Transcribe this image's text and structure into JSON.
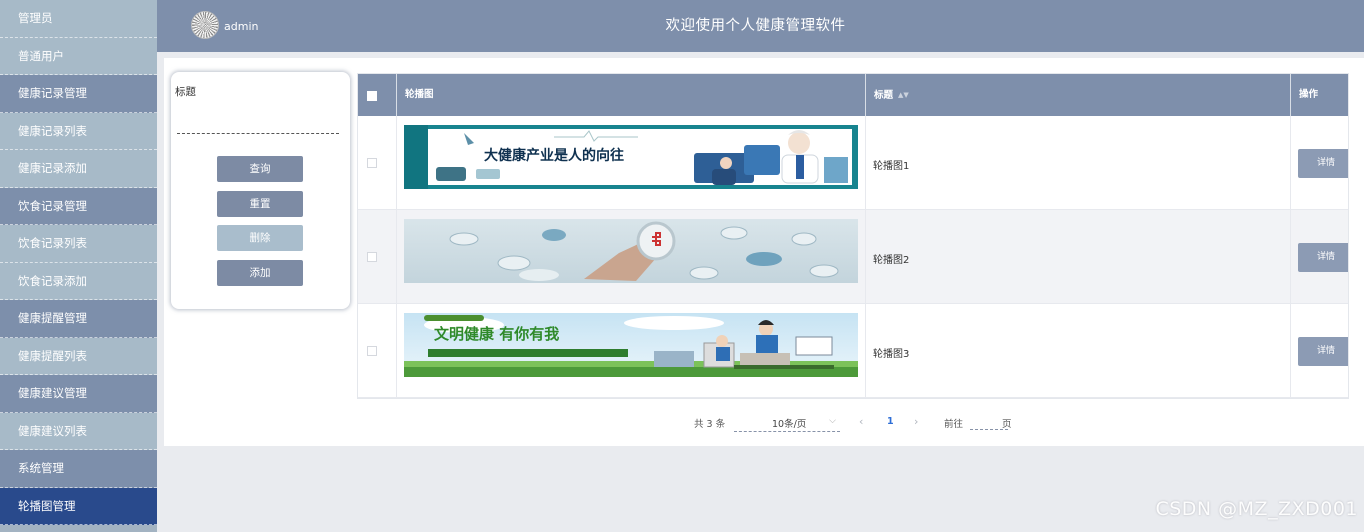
{
  "sidebar": {
    "items": [
      {
        "label": "管理员",
        "kind": "sub"
      },
      {
        "label": "普通用户",
        "kind": "sub"
      },
      {
        "label": "健康记录管理",
        "kind": "group"
      },
      {
        "label": "健康记录列表",
        "kind": "sub"
      },
      {
        "label": "健康记录添加",
        "kind": "sub"
      },
      {
        "label": "饮食记录管理",
        "kind": "group"
      },
      {
        "label": "饮食记录列表",
        "kind": "sub"
      },
      {
        "label": "饮食记录添加",
        "kind": "sub"
      },
      {
        "label": "健康提醒管理",
        "kind": "group"
      },
      {
        "label": "健康提醒列表",
        "kind": "sub"
      },
      {
        "label": "健康建议管理",
        "kind": "group"
      },
      {
        "label": "健康建议列表",
        "kind": "sub"
      },
      {
        "label": "系统管理",
        "kind": "group"
      },
      {
        "label": "轮播图管理",
        "kind": "active"
      }
    ]
  },
  "header": {
    "username": "admin",
    "title": "欢迎使用个人健康管理软件"
  },
  "search": {
    "title_label": "标题",
    "title_value": "",
    "buttons": {
      "query": "查询",
      "reset": "重置",
      "delete": "删除",
      "add": "添加"
    }
  },
  "table": {
    "columns": {
      "image": "轮播图",
      "title": "标题",
      "action": "操作"
    },
    "rows": [
      {
        "title": "轮播图1",
        "action": "详情",
        "banner_text": "大健康产业是人的向往"
      },
      {
        "title": "轮播图2",
        "action": "详情",
        "banner_text": ""
      },
      {
        "title": "轮播图3",
        "action": "详情",
        "banner_text": "文明健康 有你有我"
      }
    ]
  },
  "pagination": {
    "total": "共 3 条",
    "page_size": "10条/页",
    "current_page": "1",
    "goto_label": "前往",
    "goto_value": "",
    "page_unit": "页"
  },
  "icons": {
    "prev": "chevron-left-icon",
    "next": "chevron-right-icon",
    "dropdown": "chevron-down-icon",
    "sort": "sort-icon"
  },
  "colors": {
    "header_bg": "#7e8fab",
    "sidebar_active": "#294a8c",
    "button": "#7d8ba4",
    "page_active": "#2e6ed6"
  },
  "watermark": "CSDN @MZ_ZXD001"
}
